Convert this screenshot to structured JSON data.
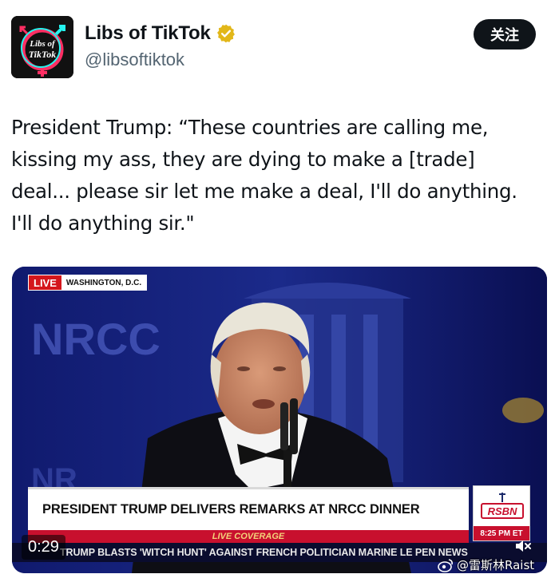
{
  "author": {
    "display_name": "Libs of TikTok",
    "handle": "@libsoftiktok",
    "avatar_text_top": "Libs of",
    "avatar_text_bottom": "TikTok",
    "verified_icon": "gold-verified-badge-icon"
  },
  "follow_button": {
    "label": "关注"
  },
  "tweet": {
    "lines": [
      "President Trump: “These countries are calling me,",
      "kissing my ass, they are dying to make a [trade]",
      "deal... please sir let me make a deal, I'll do anything.",
      "I'll do anything sir.\""
    ]
  },
  "video": {
    "live_label": "LIVE",
    "location": "WASHINGTON, D.C.",
    "backdrop_text": "NRCC",
    "headline": "PRESIDENT TRUMP DELIVERS REMARKS AT NRCC DINNER",
    "coverage": "LIVE COVERAGE",
    "network": "RSBN",
    "clock": "8:25 PM ET",
    "ticker": "TRUMP BLASTS 'WITCH HUNT' AGAINST FRENCH POLITICIAN MARINE LE PEN   NEWS",
    "duration": "0:29",
    "mute_icon": "speaker-muted-icon"
  },
  "watermark": {
    "text": "@雷斯林Raist",
    "icon": "weibo-icon"
  },
  "colors": {
    "follow_bg": "#0f1419",
    "verified": "#e2b719",
    "live_red": "#d4161c",
    "coverage_red": "#c8102e",
    "handle_gray": "#536471"
  }
}
